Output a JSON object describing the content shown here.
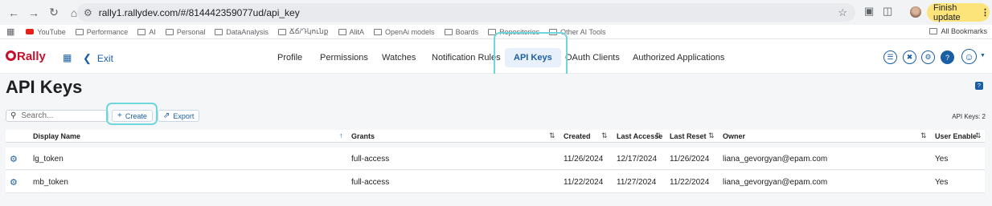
{
  "browser": {
    "url": "rally1.rallydev.com/#/814442359077ud/api_key",
    "finish_update": "Finish update",
    "bookmarks": [
      "YouTube",
      "Performance",
      "AI",
      "Personal",
      "DataAnalysis",
      "Ճճ/Դկունք",
      "AlitA",
      "OpenAi models",
      "Boards",
      "Repositories",
      "Other AI Tools"
    ],
    "all_bookmarks": "All Bookmarks"
  },
  "header": {
    "logo": "Rally",
    "exit": "Exit",
    "tabs": [
      "Profile",
      "Permissions",
      "Watches",
      "Notification Rules",
      "API Keys",
      "OAuth Clients",
      "Authorized Applications"
    ],
    "active_tab": "API Keys"
  },
  "page": {
    "title": "API Keys",
    "search_placeholder": "Search...",
    "create": "Create",
    "export": "Export",
    "count": "API Keys: 2"
  },
  "table": {
    "columns": [
      "Display Name",
      "Grants",
      "Created",
      "Last Accessed",
      "Last Reset",
      "Owner",
      "User Enabled"
    ],
    "column_texts": [
      "Display Name",
      "Grants",
      "Created",
      "Last Accesse",
      "Last Reset",
      "Owner",
      "User Enable"
    ],
    "rows": [
      {
        "name": "lg_token",
        "grants": "full-access",
        "created": "11/26/2024",
        "accessed": "12/17/2024",
        "reset": "11/26/2024",
        "owner": "liana_gevorgyan@epam.com",
        "enabled": "Yes"
      },
      {
        "name": "mb_token",
        "grants": "full-access",
        "created": "11/22/2024",
        "accessed": "11/27/2024",
        "reset": "11/22/2024",
        "owner": "liana_gevorgyan@epam.com",
        "enabled": "Yes"
      }
    ]
  },
  "colors": {
    "rally_red": "#c8102e",
    "link_blue": "#1a5fa3",
    "highlight": "#6fd6dc",
    "update_yellow": "#fce47a"
  }
}
